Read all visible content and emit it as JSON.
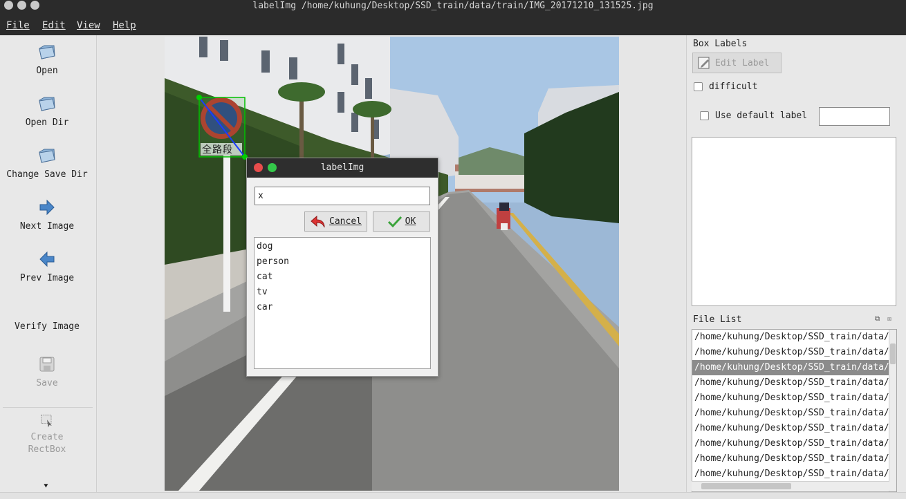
{
  "window": {
    "title": "labelImg /home/kuhung/Desktop/SSD_train/data/train/IMG_20171210_131525.jpg"
  },
  "menu": {
    "file": "File",
    "edit": "Edit",
    "view": "View",
    "help": "Help"
  },
  "toolbar": {
    "open": "Open",
    "open_dir": "Open Dir",
    "change_save_dir": "Change Save Dir",
    "next_image": "Next Image",
    "prev_image": "Prev Image",
    "verify_image": "Verify Image",
    "save": "Save",
    "create_rectbox_line1": "Create",
    "create_rectbox_line2": "RectBox"
  },
  "canvas": {
    "sign_text": "全路段"
  },
  "dialog": {
    "title": "labelImg",
    "input_value": "x",
    "cancel_label": "Cancel",
    "ok_label": "OK",
    "labels": [
      "dog",
      "person",
      "cat",
      "tv",
      "car"
    ]
  },
  "right_panel": {
    "box_labels_title": "Box Labels",
    "edit_label": "Edit Label",
    "difficult": "difficult",
    "use_default_label": "Use default label",
    "default_label_value": "",
    "file_list_title": "File List",
    "files": [
      "/home/kuhung/Desktop/SSD_train/data/train/",
      "/home/kuhung/Desktop/SSD_train/data/train/",
      "/home/kuhung/Desktop/SSD_train/data/train/",
      "/home/kuhung/Desktop/SSD_train/data/train/",
      "/home/kuhung/Desktop/SSD_train/data/train/",
      "/home/kuhung/Desktop/SSD_train/data/train/",
      "/home/kuhung/Desktop/SSD_train/data/train/",
      "/home/kuhung/Desktop/SSD_train/data/train/",
      "/home/kuhung/Desktop/SSD_train/data/train/",
      "/home/kuhung/Desktop/SSD_train/data/train/"
    ],
    "selected_file_index": 2
  },
  "colors": {
    "dark_bar": "#2b2b2b",
    "selection": "#8b8b8b",
    "bbox": "#00c000",
    "close_button": "#e84c4c",
    "max_button": "#34c84a",
    "icon_blue": "#4a86c8"
  }
}
